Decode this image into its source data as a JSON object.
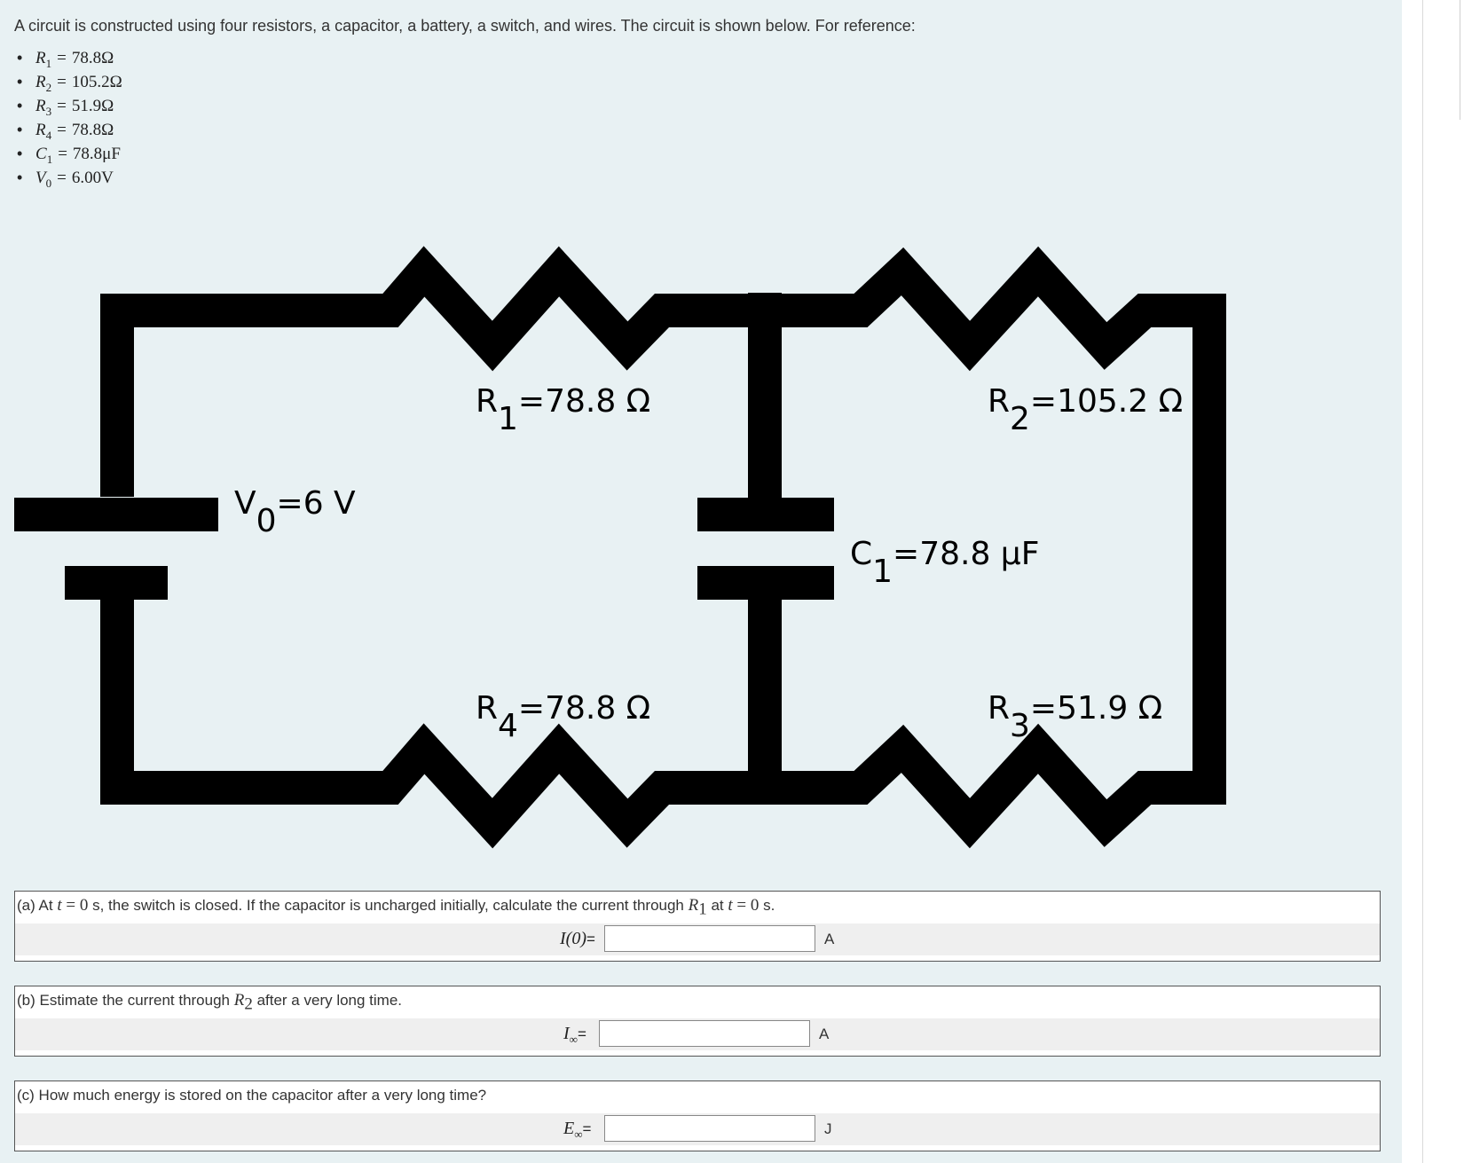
{
  "intro": "A circuit is constructed using four resistors, a capacitor, a battery, a switch, and wires. The circuit is shown below. For reference:",
  "reference": [
    {
      "sym": "R",
      "sub": "1",
      "value": "78.8Ω"
    },
    {
      "sym": "R",
      "sub": "2",
      "value": "105.2Ω"
    },
    {
      "sym": "R",
      "sub": "3",
      "value": "51.9Ω"
    },
    {
      "sym": "R",
      "sub": "4",
      "value": "78.8Ω"
    },
    {
      "sym": "C",
      "sub": "1",
      "value": "78.8μF"
    },
    {
      "sym": "V",
      "sub": "0",
      "value": "6.00V"
    }
  ],
  "circuit": {
    "battery": {
      "base": "V",
      "sub": "0",
      "rest": "=6 V"
    },
    "r1": {
      "base": "R",
      "sub": "1",
      "rest": "=78.8 Ω"
    },
    "r2": {
      "base": "R",
      "sub": "2",
      "rest": "=105.2 Ω"
    },
    "r3": {
      "base": "R",
      "sub": "3",
      "rest": "=51.9 Ω"
    },
    "r4": {
      "base": "R",
      "sub": "4",
      "rest": "=78.8 Ω"
    },
    "c1": {
      "base": "C",
      "sub": "1",
      "rest": "=78.8 μF"
    }
  },
  "questions": {
    "a": {
      "prefix": "(a) At ",
      "t1": "t",
      "eq1": " = 0",
      "mid": " s, the switch is closed. If the capacitor is uncharged initially, calculate the current through ",
      "r": "R",
      "rsub": "1",
      "mid2": " at ",
      "t2": "t",
      "eq2": " = 0",
      "end": " s.",
      "answer_label": "I(0)",
      "eq": "=",
      "value": "",
      "unit": "A"
    },
    "b": {
      "prefix": "(b) Estimate the current through ",
      "r": "R",
      "rsub": "2",
      "end": " after a very long time.",
      "answer_label": "I",
      "answer_sub": "∞",
      "eq": "=",
      "value": "",
      "unit": "A"
    },
    "c": {
      "text": "(c) How much energy is stored on the capacitor after a very long time?",
      "answer_label": "E",
      "answer_sub": "∞",
      "eq": "=",
      "value": "",
      "unit": "J"
    }
  }
}
